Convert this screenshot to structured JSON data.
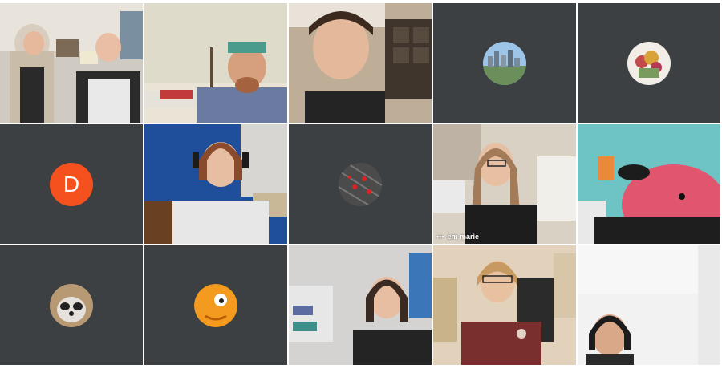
{
  "meeting": {
    "participants": [
      {
        "id": "p1",
        "type": "video"
      },
      {
        "id": "p2",
        "type": "video"
      },
      {
        "id": "p3",
        "type": "video"
      },
      {
        "id": "p4",
        "type": "avatar",
        "avatar": "city-skyline-icon"
      },
      {
        "id": "p5",
        "type": "avatar",
        "avatar": "flowers-icon"
      },
      {
        "id": "p6",
        "type": "letter",
        "letter": "D"
      },
      {
        "id": "p7",
        "type": "video"
      },
      {
        "id": "p8",
        "type": "avatar",
        "avatar": "red-objects-icon"
      },
      {
        "id": "p9",
        "type": "video",
        "name": "em marie",
        "speaking": true
      },
      {
        "id": "p10",
        "type": "video"
      },
      {
        "id": "p11",
        "type": "avatar",
        "avatar": "raccoon-icon"
      },
      {
        "id": "p12",
        "type": "avatar",
        "avatar": "orange-creature-icon"
      },
      {
        "id": "p13",
        "type": "video"
      },
      {
        "id": "p14",
        "type": "video"
      },
      {
        "id": "p15",
        "type": "video"
      }
    ],
    "colors": {
      "tile_bg": "#3c4043",
      "letter_avatar": "#f4511e",
      "speaking_border": "#3ec1d3"
    }
  }
}
